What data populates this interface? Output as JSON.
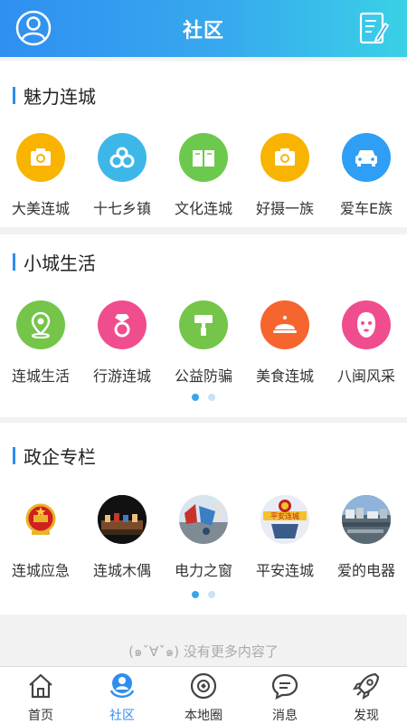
{
  "header": {
    "title": "社区",
    "left_icon": "user-avatar-icon",
    "right_icon": "edit-note-icon"
  },
  "sections": [
    {
      "title": "魅力连城",
      "items": [
        {
          "label": "大美连城",
          "icon": "camera-icon",
          "color": "#f8b400"
        },
        {
          "label": "十七乡镇",
          "icon": "flower-icon",
          "color": "#3db7e8"
        },
        {
          "label": "文化连城",
          "icon": "book-icon",
          "color": "#6cc94d"
        },
        {
          "label": "好摄一族",
          "icon": "camera-icon",
          "color": "#f8b400"
        },
        {
          "label": "爱车E族",
          "icon": "car-icon",
          "color": "#2f9ef5"
        }
      ]
    },
    {
      "title": "小城生活",
      "items": [
        {
          "label": "连城生活",
          "icon": "location-pin-icon",
          "color": "#74c54a"
        },
        {
          "label": "行游连城",
          "icon": "diamond-ring-icon",
          "color": "#f04d8e"
        },
        {
          "label": "公益防骗",
          "icon": "paint-roller-icon",
          "color": "#74c54a"
        },
        {
          "label": "美食连城",
          "icon": "food-cloche-icon",
          "color": "#f6652e"
        },
        {
          "label": "八闽风采",
          "icon": "face-mask-icon",
          "color": "#f04d8e"
        }
      ]
    },
    {
      "title": "政企专栏",
      "items": [
        {
          "label": "连城应急",
          "icon": "national-emblem-icon",
          "color": "#ffffff"
        },
        {
          "label": "连城木偶",
          "icon": "puppet-photo-icon",
          "color": "#1a1a1a"
        },
        {
          "label": "电力之窗",
          "icon": "power-photo-icon",
          "color": "#c9d6e6"
        },
        {
          "label": "平安连城",
          "icon": "police-emblem-icon",
          "color": "#e9edf3"
        },
        {
          "label": "爱的电器",
          "icon": "city-photo-icon",
          "color": "#6f93b8"
        }
      ]
    }
  ],
  "footer_text": "(๑ˇ∀ˇ๑) 没有更多内容了",
  "tabbar": [
    {
      "label": "首页",
      "icon": "home-icon",
      "active": false
    },
    {
      "label": "社区",
      "icon": "community-icon",
      "active": true
    },
    {
      "label": "本地圈",
      "icon": "local-circle-icon",
      "active": false
    },
    {
      "label": "消息",
      "icon": "message-icon",
      "active": false
    },
    {
      "label": "发现",
      "icon": "rocket-icon",
      "active": false
    }
  ],
  "colors": {
    "accent": "#2e8ef0",
    "header_start": "#2f8ff1",
    "header_end": "#3ad1e6"
  }
}
